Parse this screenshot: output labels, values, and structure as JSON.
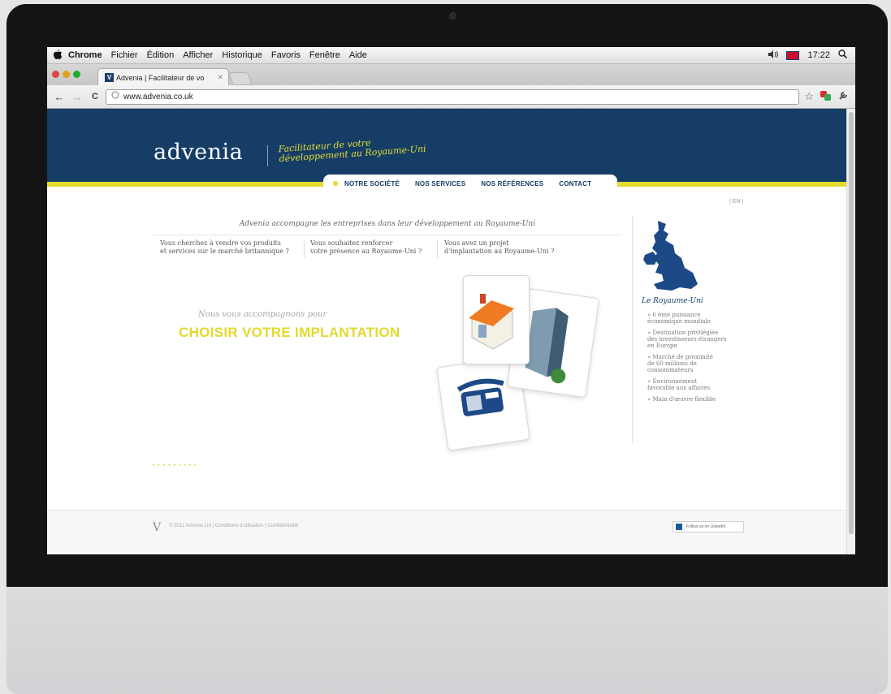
{
  "menubar": {
    "apple": "",
    "items": [
      "Chrome",
      "Fichier",
      "Édition",
      "Afficher",
      "Historique",
      "Favoris",
      "Fenêtre",
      "Aide"
    ],
    "volume": "🔈",
    "time": "17:22",
    "search": "⚲"
  },
  "browser": {
    "tab_favicon": "V",
    "tab_title": "Advenia | Facilitateur de vo",
    "tab_close": "✕",
    "back": "←",
    "forward": "→",
    "reload": "C",
    "url": "www.advenia.co.uk",
    "star": "☆",
    "wrench": "🔧"
  },
  "site": {
    "logo": "advenia",
    "tagline": "Facilitateur de votre\ndéveloppement au Royaume-Uni",
    "nav": [
      "NOTRE SOCIÉTÉ",
      "NOS SERVICES",
      "NOS RÉFÉRENCES",
      "CONTACT"
    ],
    "lang": "| EN |",
    "lead": "Advenia accompagne les entreprises dans leur développement au Royaume-Uni",
    "columns": [
      "Vous cherchez à vendre vos produits\net services sur le marché britannique ?",
      "Vous souhaitez renforcer\nvotre présence au Royaume-Uni ?",
      "Vous avez un projet\nd'implantation au Royaume-Uni ?"
    ],
    "hero_small": "Nous vous accompagnons pour",
    "hero_big": "CHOISIR VOTRE IMPLANTATION",
    "pager_dots": "• • • • • • • • •",
    "sidebar": {
      "title": "Le Royaume-Uni",
      "items": [
        "» 6 ème puissance\néconomique mondiale",
        "» Destination privilégiée\ndes investisseurs étrangers\nen Europe",
        "» Marché de proximité\nde 60 millions de\nconsommateurs",
        "» Environnement\nfavorable aux affaires",
        "» Main d'œuvre flexible"
      ]
    },
    "footer": {
      "logo": "V",
      "text": "© 2011 Advenia Ltd   |   Conditions d'utilisation   |   Confidentialité",
      "linkedin": "Follow us on LinkedIn"
    }
  },
  "colors": {
    "navy": "#153d66",
    "accent_yellow": "#e2dc2e"
  }
}
